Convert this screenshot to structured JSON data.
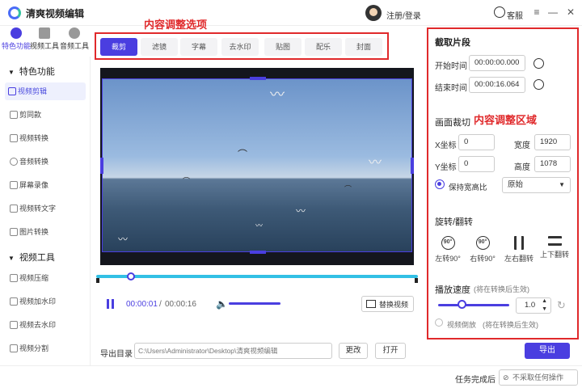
{
  "app": {
    "title": "清爽视频编辑"
  },
  "header": {
    "login": "注册/登录",
    "service": "客服",
    "minimize": "—",
    "close": "✕"
  },
  "nav_tabs": [
    {
      "label": "特色功能",
      "color": "#4a3ee0"
    },
    {
      "label": "视频工具",
      "color": "#888888"
    },
    {
      "label": "音频工具",
      "color": "#888888"
    }
  ],
  "sidebar": {
    "section1": "特色功能",
    "section1_items": [
      "视频剪辑",
      "剪同款",
      "视频转换",
      "音频转换",
      "屏幕录像",
      "视频转文字",
      "图片转换"
    ],
    "section2": "视频工具",
    "section2_items": [
      "视频压缩",
      "视频加水印",
      "视频去水印",
      "视频分割"
    ],
    "active_item": "视频剪辑"
  },
  "edit_tabs": {
    "annotation": "内容调整选项",
    "items": [
      "裁剪",
      "滤镜",
      "字幕",
      "去水印",
      "贴图",
      "配乐",
      "封面"
    ],
    "active": "裁剪"
  },
  "player": {
    "time_current": "00:00:01",
    "separator": "/",
    "time_total": "00:00:16",
    "replace_video": "替换视频"
  },
  "export": {
    "label": "导出目录",
    "path": "C:\\Users\\Administrator\\Desktop\\清爽视频编辑",
    "change": "更改",
    "open": "打开",
    "export_btn": "导出"
  },
  "clip": {
    "title": "截取片段",
    "start_label": "开始时间",
    "start_value": "00:00:00.000",
    "end_label": "结束时间",
    "end_value": "00:00:16.064"
  },
  "crop": {
    "title": "画面裁切",
    "annotation": "内容调整区域",
    "x_label": "X坐标",
    "x_value": "0",
    "y_label": "Y坐标",
    "y_value": "0",
    "width_label": "宽度",
    "width_value": "1920",
    "height_label": "高度",
    "height_value": "1078",
    "keep_ratio_label": "保持宽高比",
    "ratio_value": "原始"
  },
  "rotate": {
    "title": "旋转/翻转",
    "left_icon_text": "90°",
    "right_icon_text": "90°",
    "left": "左转90°",
    "right": "右转90°",
    "flip_h": "左右翻转",
    "flip_v": "上下翻转"
  },
  "speed": {
    "label": "播放速度",
    "note": "(将在转换后生效)",
    "value": "1.0",
    "level_fraction": 0.3,
    "reverse_label": "视频倒放",
    "reverse_note": "(将在转换后生效)"
  },
  "footer": {
    "task_done_label": "任务完成后",
    "task_done_value": "不采取任何操作"
  },
  "colors": {
    "accent": "#4a3ee0",
    "annotation_red": "#e0292b",
    "timeline": "#32c0e5"
  }
}
